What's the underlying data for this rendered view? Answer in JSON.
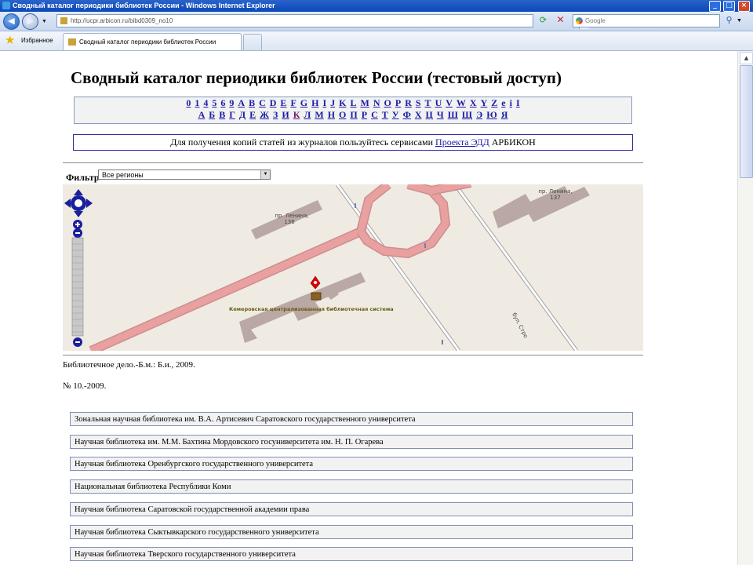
{
  "window": {
    "title": "Сводный каталог периодики библиотек России - Windows Internet Explorer"
  },
  "toolbar": {
    "address": "http://ucpr.arbicon.ru/bibd0309_no10",
    "address_host": "ucpr.arbicon.ru",
    "search_placeholder": "Google"
  },
  "favbar": {
    "favorites_label": "Избранное",
    "tab_title": "Сводный каталог периодики библиотек России"
  },
  "page": {
    "title": "Сводный каталог периодики библиотек России (тестовый доступ)",
    "latin_letters": [
      "0",
      "1",
      "4",
      "5",
      "6",
      "9",
      "A",
      "B",
      "C",
      "D",
      "E",
      "F",
      "G",
      "H",
      "I",
      "J",
      "K",
      "L",
      "M",
      "N",
      "O",
      "P",
      "R",
      "S",
      "T",
      "U",
      "V",
      "W",
      "X",
      "Y",
      "Z",
      "e",
      "i",
      "I"
    ],
    "cyrillic_letters": [
      "А",
      "Б",
      "В",
      "Г",
      "Д",
      "Е",
      "Ж",
      "З",
      "И",
      "К",
      "Л",
      "М",
      "Н",
      "О",
      "П",
      "Р",
      "С",
      "Т",
      "У",
      "Ф",
      "Х",
      "Ц",
      "Ч",
      "Ш",
      "Щ",
      "Э",
      "Ю",
      "Я"
    ],
    "edd_prefix": "Для получения копий статей из журналов пользуйтесь сервисами",
    "edd_link": "Проекта ЭДД",
    "edd_suffix": "АРБИКОН",
    "filter_label": "Фильтр",
    "filter_value": "Все регионы",
    "bibliographic": "Библиотечное дело.-Б.м.: Б.и., 2009.",
    "issue": "№ 10.-2009."
  },
  "map": {
    "labels": {
      "street_left": "пр. Ленина,",
      "house_left": "136",
      "street_right": "пр. Ленина,",
      "house_right": "137",
      "library": "Кемеровская централизованная библиотечная система",
      "boulevard": "бул. Стро"
    }
  },
  "libraries": [
    "Зональная научная библиотека им. В.А. Артисевич Саратовского государственного университета",
    "Научная библиотека им. М.М. Бахтина Мордовского госуниверситета им. Н. П. Огарева",
    "Научная библиотека Оренбургского государственного университета",
    "Национальная библиотека Республики Коми",
    "Научная библиотека Саратовской государственной академии права",
    "Научная библиотека Сыктывкарского государственного университета",
    "Научная библиотека Тверского государственного университета"
  ],
  "colors": {
    "road": "#e8a0a0",
    "building": "#b9a8a3",
    "map_bg": "#efebe3",
    "link": "#1a1aa6",
    "pan_control": "#1a1f9c"
  }
}
